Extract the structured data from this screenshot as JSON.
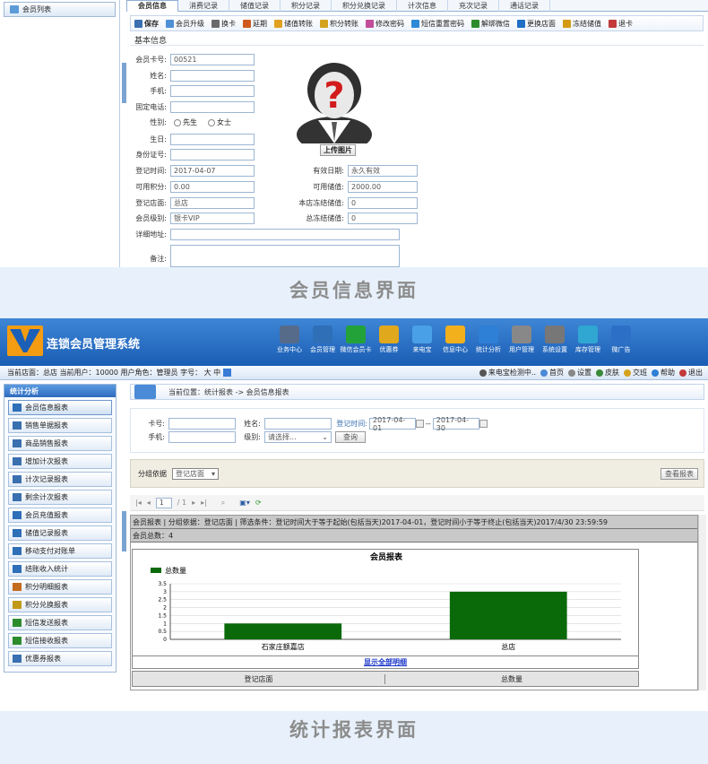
{
  "top": {
    "sidebar": {
      "item": "会员列表"
    },
    "tabs": [
      "会员信息",
      "消费记录",
      "储值记录",
      "积分记录",
      "积分兑换记录",
      "计次信息",
      "充次记录",
      "通话记录"
    ],
    "toolbar": [
      "保存",
      "会员升级",
      "换卡",
      "延期",
      "储值转账",
      "积分转账",
      "修改密码",
      "短信重置密码",
      "解绑微信",
      "更换店面",
      "冻结储值",
      "退卡"
    ],
    "section": "基本信息",
    "fields": {
      "card_label": "会员卡号:",
      "card_value": "00521",
      "name_label": "姓名:",
      "mobile_label": "手机:",
      "phone_label": "固定电话:",
      "gender_label": "性别:",
      "male": "先生",
      "female": "女士",
      "birthday_label": "生日:",
      "idcard_label": "身份证号:",
      "regtime_label": "登记时间:",
      "regtime_value": "2017-04-07",
      "valid_label": "有效日期:",
      "valid_value": "永久有效",
      "points_label": "可用积分:",
      "points_value": "0.00",
      "stored_label": "可用储值:",
      "stored_value": "2000.00",
      "store_label": "登记店面:",
      "store_value": "总店",
      "frozen_local_label": "本店冻结储值:",
      "frozen_local_value": "0",
      "level_label": "会员级别:",
      "level_value": "银卡VIP",
      "frozen_total_label": "总冻结储值:",
      "frozen_total_value": "0",
      "address_label": "详细地址:",
      "remark_label": "备注:"
    },
    "upload": "上传图片"
  },
  "caption1": "会员信息界面",
  "app": {
    "title": "连锁会员管理系统",
    "nav": [
      "业务中心",
      "会员管理",
      "微信会员卡",
      "优惠券",
      "来电宝",
      "信息中心",
      "统计分析",
      "用户管理",
      "系统设置",
      "库存管理",
      "微广告"
    ],
    "status": "当前店面：总店  当前用户：10000  用户角色：管理员  字号：  大  中",
    "status_right": [
      "来电宝检测中..",
      "首页",
      "设置",
      "皮肤",
      "交班",
      "帮助",
      "退出"
    ],
    "menu_head": "统计分析",
    "menu": [
      "会员信息报表",
      "销售单据报表",
      "商品销售报表",
      "增加计次报表",
      "计次记录报表",
      "剩余计次报表",
      "会员充值报表",
      "储值记录报表",
      "移动支付对账单",
      "结账收入统计",
      "积分明细报表",
      "积分兑换报表",
      "短信发送报表",
      "短信接收报表",
      "优惠券报表"
    ],
    "crumb": "当前位置：统计报表 -> 会员信息报表",
    "search": {
      "card_label": "卡号:",
      "name_label": "姓名:",
      "regtime_label": "登记时间:",
      "date_from": "2017-04-01",
      "sep": "--",
      "date_to": "2017-04-30",
      "mobile_label": "手机:",
      "level_label": "级别:",
      "level_value": "请选择...",
      "query": "查询"
    },
    "group_label": "分组依据",
    "group_value": "登记店面",
    "view_report": "查看报表",
    "pager": {
      "page": "1",
      "total": "/ 1"
    },
    "report_head1": "会员报表 | 分组依据：登记店面 | 筛选条件：登记时间大于等于起始(包括当天)2017-04-01，登记时间小于等于终止(包括当天)2017/4/30 23:59:59",
    "report_head2": "会员总数：4",
    "show_all": "显示全部明细",
    "col1": "登记店面",
    "col2": "总数量"
  },
  "chart_data": {
    "type": "bar",
    "title": "会员报表",
    "categories": [
      "石家庄额嘉店",
      "总店"
    ],
    "series": [
      {
        "name": "总数量",
        "values": [
          1,
          3
        ]
      }
    ],
    "ylim": [
      0,
      3.5
    ],
    "yticks": [
      "0",
      "0.5",
      "1",
      "1.5",
      "2",
      "2.5",
      "3",
      "3.5"
    ],
    "legend": "top-left",
    "color": "#0a6a0a",
    "grid": true
  },
  "caption2": "统计报表界面"
}
